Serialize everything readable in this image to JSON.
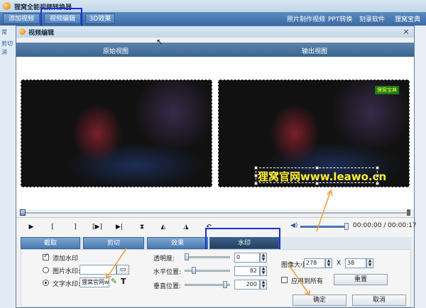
{
  "app": {
    "title": "狸窝全能视频转换器",
    "tabs": [
      "添加视频",
      "视频编辑",
      "3D效果"
    ],
    "links": [
      "照片制作视频",
      "PPT转换",
      "刻录软件",
      "狸窝宝典"
    ],
    "strip": [
      "常",
      "消",
      "剪切",
      "消删"
    ]
  },
  "dialog": {
    "title": "视频编辑",
    "close": "×",
    "original_view": "原始视图",
    "output_view": "输出视图",
    "mini_logo": "狸窝宝典",
    "watermark_preview": "狸窝官网www.leawo.cn",
    "time": "00:00:00 / 00:00:17"
  },
  "controls": {
    "play": "▶",
    "mark_in": "[",
    "mark_out": "]",
    "play_section": "[▶]",
    "next_frame": "▶|",
    "flip_vertical": "⧗",
    "flip_h": "◭",
    "flip_h2": "◮",
    "rotate": "↶"
  },
  "edit_tabs": [
    "截取",
    "剪切",
    "效果",
    "水印"
  ],
  "watermark_panel": {
    "add_watermark": "添加水印",
    "image_watermark": "图片水印:",
    "text_watermark": "文字水印:",
    "text_value": "狸窝官网www.leawo.cn",
    "transparency_label": "透明度:",
    "transparency_value": "0",
    "horizontal_label": "水平位置:",
    "horizontal_value": "82",
    "vertical_label": "垂直位置:",
    "vertical_value": "200",
    "image_size_label": "图像大小",
    "width": "278",
    "x": "X",
    "height": "38",
    "apply_all": "应用到所有",
    "reset": "重置",
    "ok": "确定",
    "cancel": "取消",
    "levels": {
      "transparency": 0.0,
      "horizontal": 0.19,
      "vertical": 0.9
    }
  },
  "colors": {
    "accent": "#3b6aa3",
    "highlight": "#1a2ddb",
    "annotation": "#f0a040",
    "watermark_text": "#ffee33"
  }
}
